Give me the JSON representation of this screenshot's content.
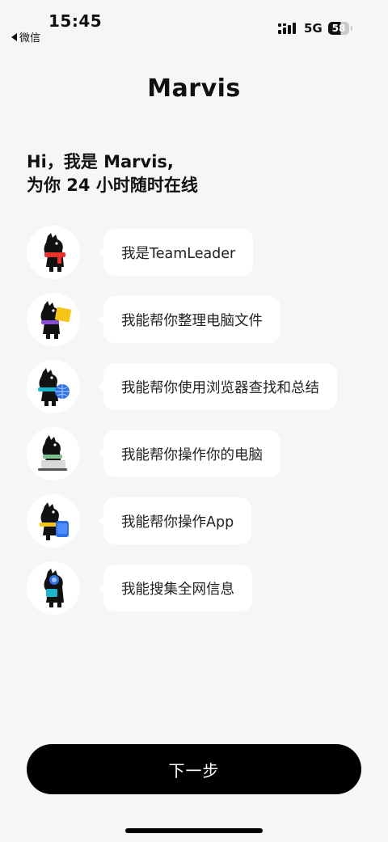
{
  "status_bar": {
    "time": "15:45",
    "back_app": "微信",
    "network": "5G",
    "battery": "58"
  },
  "brand": "Marvis",
  "greeting": {
    "line1": "Hi，我是 Marvis,",
    "line2": "为你 24 小时随时在线"
  },
  "features": [
    {
      "label": "我是TeamLeader",
      "accent": "#e8322b",
      "icon": "horse-mascot-scarf-icon"
    },
    {
      "label": "我能帮你整理电脑文件",
      "accent": "#f5c518",
      "icon": "horse-mascot-folder-icon"
    },
    {
      "label": "我能帮你使用浏览器查找和总结",
      "accent": "#2f6fe4",
      "icon": "horse-mascot-globe-icon"
    },
    {
      "label": "我能帮你操作你的电脑",
      "accent": "#9acd9a",
      "icon": "horse-mascot-laptop-icon"
    },
    {
      "label": "我能帮你操作App",
      "accent": "#2f6fe4",
      "icon": "horse-mascot-phone-icon"
    },
    {
      "label": "我能搜集全网信息",
      "accent": "#2f6fe4",
      "icon": "horse-mascot-search-icon"
    }
  ],
  "next_button": "下一步"
}
